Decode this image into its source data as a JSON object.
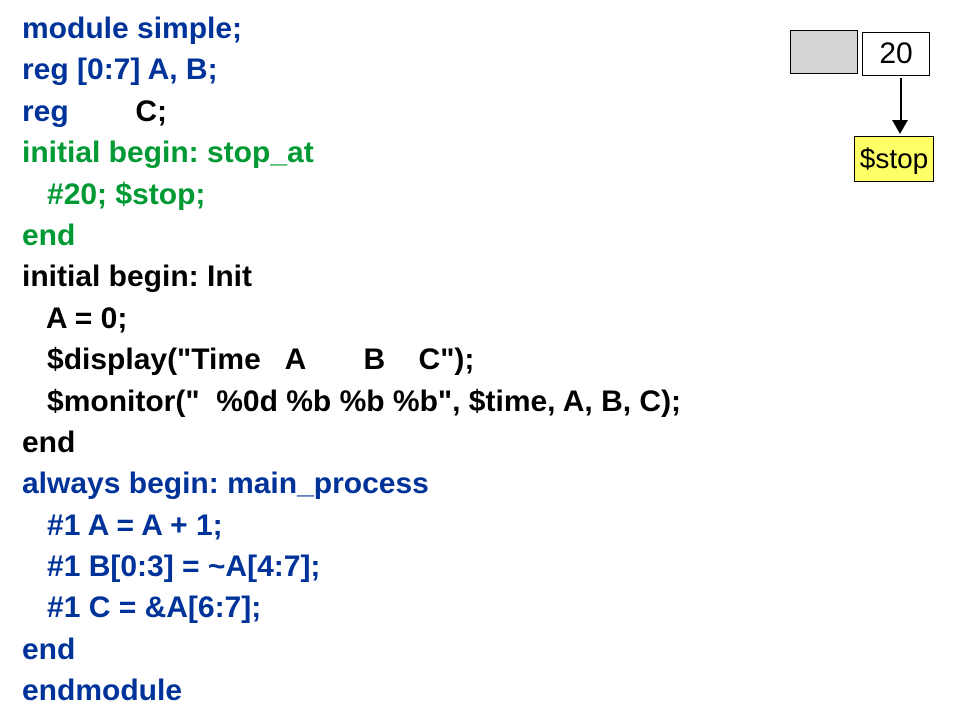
{
  "code": {
    "l1": "module simple;",
    "l2": "reg [0:7] A, B;",
    "l3a": "reg",
    "l3b": "        C;",
    "l4": "initial begin: stop_at",
    "l5": "   #20; $stop;",
    "l6": "end",
    "l7": "initial begin: Init",
    "l8": "   A = 0;",
    "l9": "   $display(\"Time   A       B    C\");",
    "l10": "   $monitor(\"  %0d %b %b %b\", $time, A, B, C);",
    "l11": "end",
    "l12": "always begin: main_process",
    "l13": "   #1 A = A + 1;",
    "l14": "   #1 B[0:3] = ~A[4:7];",
    "l15": "   #1 C = &A[6:7];",
    "l16": "end",
    "l17": "endmodule"
  },
  "diagram": {
    "ellipsis": "…",
    "value": "20",
    "stop": "$stop"
  }
}
